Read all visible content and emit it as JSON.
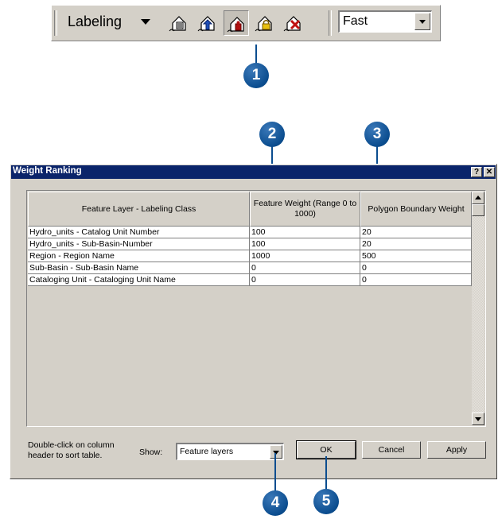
{
  "toolbar": {
    "menu_label": "Labeling",
    "buttons": [
      {
        "name": "label-manager-icon"
      },
      {
        "name": "label-priority-icon"
      },
      {
        "name": "label-weight-ranking-icon"
      },
      {
        "name": "lock-labels-icon"
      },
      {
        "name": "view-unplaced-labels-icon"
      }
    ],
    "quality_value": "Fast"
  },
  "callouts": [
    "1",
    "2",
    "3",
    "4",
    "5"
  ],
  "dialog": {
    "title": "Weight Ranking",
    "help_label": "?",
    "close_label": "✕",
    "table": {
      "headers": {
        "layer": "Feature Layer - Labeling Class",
        "feature_weight": "Feature Weight (Range 0 to 1000)",
        "polygon_weight": "Polygon Boundary Weight"
      },
      "rows": [
        {
          "layer": "Hydro_units - Catalog Unit Number",
          "feature_weight": "100",
          "polygon_weight": "20"
        },
        {
          "layer": "Hydro_units - Sub-Basin-Number",
          "feature_weight": "100",
          "polygon_weight": "20"
        },
        {
          "layer": "Region - Region Name",
          "feature_weight": "1000",
          "polygon_weight": "500"
        },
        {
          "layer": "Sub-Basin - Sub-Basin Name",
          "feature_weight": "0",
          "polygon_weight": "0"
        },
        {
          "layer": "Cataloging Unit - Cataloging Unit Name",
          "feature_weight": "0",
          "polygon_weight": "0"
        }
      ]
    },
    "hint": "Double-click on column header to sort table.",
    "show_label": "Show:",
    "show_value": "Feature layers",
    "buttons": {
      "ok": "OK",
      "cancel": "Cancel",
      "apply": "Apply"
    }
  }
}
